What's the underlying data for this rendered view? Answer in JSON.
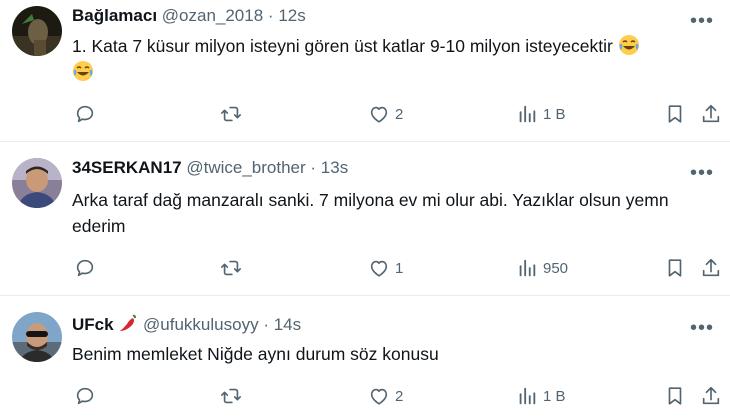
{
  "tweets": [
    {
      "name": "Bağlamacı",
      "handle": "@ozan_2018",
      "dot": "·",
      "time": "12s",
      "text_line1": "1. Kata 7 küsur milyon isteyni gören üst katlar 9-10 milyon isteyecektir",
      "text_line2": "",
      "emoji": "face-with-tears-of-joy",
      "reply_count": "",
      "retweet_count": "",
      "like_count": "2",
      "views_count": "1 B"
    },
    {
      "name": "34SERKAN17",
      "handle": "@twice_brother",
      "dot": "·",
      "time": "13s",
      "text_line1": "Arka taraf dağ manzaralı sanki. 7 milyona ev mi olur abi. Yazıklar olsun yemn",
      "text_line2": "ederim",
      "reply_count": "",
      "retweet_count": "",
      "like_count": "1",
      "views_count": "950"
    },
    {
      "name": "UFck",
      "handle": "@ufukkulusoyy",
      "dot": "·",
      "time": "14s",
      "text_line1": "Benim memleket Niğde aynı durum söz konusu",
      "text_line2": "",
      "reply_count": "",
      "retweet_count": "",
      "like_count": "2",
      "views_count": "1 B"
    }
  ],
  "icons": {
    "more": "more-horizontal-icon",
    "reply": "reply-icon",
    "retweet": "retweet-icon",
    "like": "heart-icon",
    "views": "bar-chart-icon",
    "bookmark": "bookmark-icon",
    "share": "share-icon"
  },
  "colors": {
    "text": "#0f1419",
    "muted": "#536471",
    "divider": "#e6ecf0"
  }
}
